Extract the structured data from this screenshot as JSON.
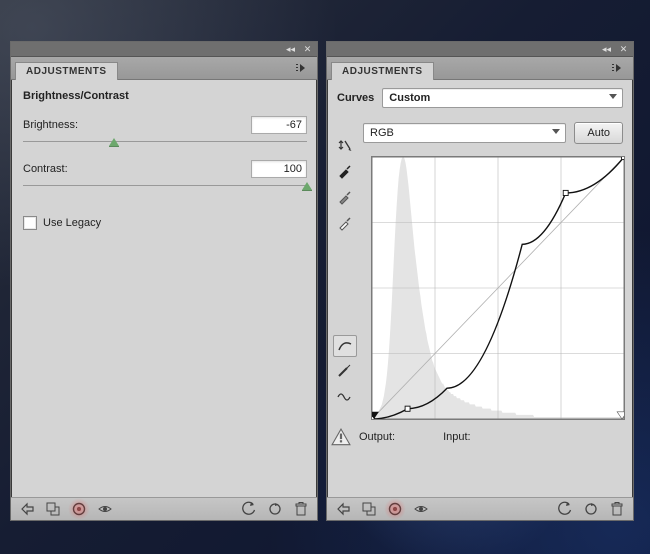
{
  "left_panel": {
    "tab_label": "ADJUSTMENTS",
    "section_title": "Brightness/Contrast",
    "brightness_label": "Brightness:",
    "brightness_value": "-67",
    "contrast_label": "Contrast:",
    "contrast_value": "100",
    "use_legacy_label": "Use Legacy"
  },
  "right_panel": {
    "tab_label": "ADJUSTMENTS",
    "section_title": "Curves",
    "preset_value": "Custom",
    "channel_value": "RGB",
    "auto_label": "Auto",
    "output_label": "Output:",
    "input_label": "Input:"
  },
  "chart_data": {
    "type": "line",
    "title": "Curves — RGB",
    "xlabel": "Input",
    "ylabel": "Output",
    "xlim": [
      0,
      255
    ],
    "ylim": [
      0,
      255
    ],
    "series": [
      {
        "name": "baseline",
        "x": [
          0,
          255
        ],
        "y": [
          0,
          255
        ]
      },
      {
        "name": "curve",
        "x": [
          0,
          36,
          76,
          152,
          196,
          255
        ],
        "y": [
          0,
          10,
          30,
          170,
          220,
          255
        ]
      }
    ],
    "control_points": [
      {
        "x": 0,
        "y": 0
      },
      {
        "x": 36,
        "y": 10
      },
      {
        "x": 196,
        "y": 220
      },
      {
        "x": 255,
        "y": 255
      }
    ],
    "histogram_bins_0_255": [
      0,
      0,
      1,
      1,
      2,
      2,
      3,
      4,
      5,
      6,
      7,
      9,
      11,
      14,
      17,
      21,
      26,
      32,
      39,
      47,
      56,
      66,
      76,
      86,
      95,
      103,
      110,
      116,
      120,
      123,
      125,
      126,
      126,
      125,
      123,
      120,
      116,
      112,
      107,
      102,
      97,
      92,
      87,
      82,
      78,
      74,
      70,
      66,
      62,
      59,
      55,
      52,
      49,
      46,
      43,
      41,
      38,
      36,
      34,
      32,
      30,
      28,
      27,
      25,
      24,
      23,
      22,
      21,
      20,
      19,
      18,
      17,
      17,
      16,
      15,
      15,
      14,
      14,
      13,
      13,
      12,
      12,
      12,
      11,
      11,
      11,
      10,
      10,
      10,
      10,
      9,
      9,
      9,
      9,
      8,
      8,
      8,
      8,
      8,
      7,
      7,
      7,
      7,
      7,
      7,
      6,
      6,
      6,
      6,
      6,
      6,
      6,
      5,
      5,
      5,
      5,
      5,
      5,
      5,
      5,
      5,
      4,
      4,
      4,
      4,
      4,
      4,
      4,
      4,
      4,
      4,
      4,
      3,
      3,
      3,
      3,
      3,
      3,
      3,
      3,
      3,
      3,
      3,
      3,
      3,
      3,
      2,
      2,
      2,
      2,
      2,
      2,
      2,
      2,
      2,
      2,
      2,
      2,
      2,
      2,
      2,
      2,
      2,
      2,
      1,
      1,
      1,
      1,
      1,
      1,
      1,
      1,
      1,
      1,
      1,
      1,
      1,
      1,
      1,
      1,
      1,
      1,
      1,
      1,
      1,
      1,
      1,
      1,
      1,
      1,
      1,
      1,
      1,
      1,
      1,
      1,
      1,
      1,
      1,
      1,
      1,
      1,
      1,
      1,
      1,
      1,
      1,
      1,
      1,
      1,
      1,
      1,
      1,
      1,
      1,
      1,
      1,
      1,
      1,
      1,
      1,
      1,
      1,
      1,
      1,
      1,
      1,
      1,
      1,
      1,
      1,
      1,
      1,
      1,
      1,
      1,
      1,
      1,
      1,
      1,
      1,
      1,
      1,
      1,
      1,
      1,
      1,
      1,
      1,
      1,
      1,
      1,
      1,
      1,
      1
    ]
  }
}
